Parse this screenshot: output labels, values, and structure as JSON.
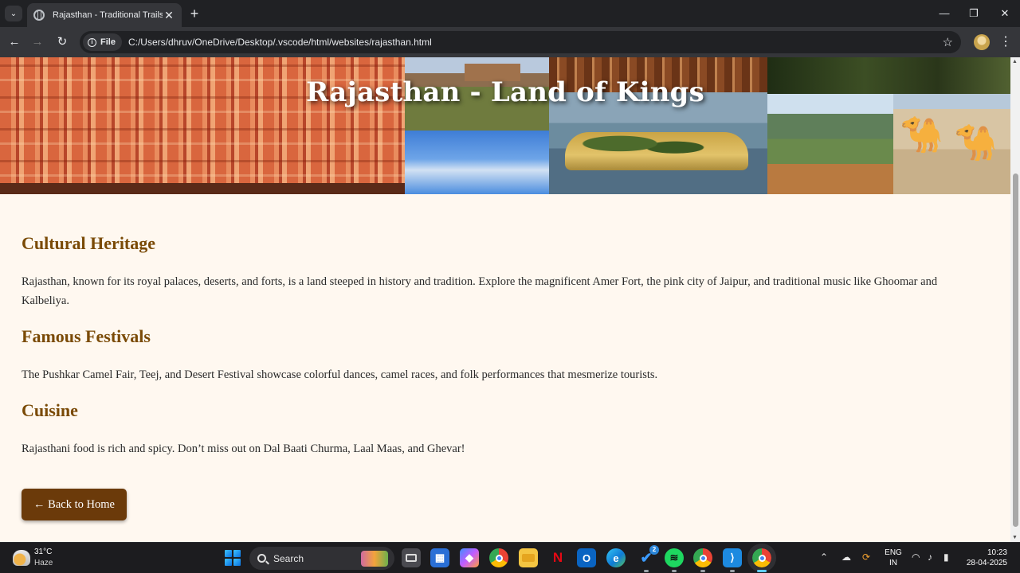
{
  "browser": {
    "tab_title": "Rajasthan - Traditional Trails",
    "tab_close": "✕",
    "new_tab": "+",
    "chip_label": "File",
    "url": "C:/Users/dhruv/OneDrive/Desktop/.vscode/html/websites/rajasthan.html",
    "bookmark_icon": "star-icon"
  },
  "page": {
    "banner_title": "Rajasthan - Land of Kings",
    "sections": [
      {
        "heading": "Cultural Heritage",
        "text": "Rajasthan, known for its royal palaces, deserts, and forts, is a land steeped in history and tradition. Explore the magnificent Amer Fort, the pink city of Jaipur, and traditional music like Ghoomar and Kalbeliya."
      },
      {
        "heading": "Famous Festivals",
        "text": "The Pushkar Camel Fair, Teej, and Desert Festival showcase colorful dances, camel races, and folk performances that mesmerize tourists."
      },
      {
        "heading": "Cuisine",
        "text": "Rajasthani food is rich and spicy. Don’t miss out on Dal Baati Churma, Laal Maas, and Ghevar!"
      }
    ],
    "back_button": "← Back to Home",
    "colors": {
      "background": "#fff8f0",
      "heading": "#7a4a06",
      "button": "#6b3a0a"
    }
  },
  "taskbar": {
    "weather_temp": "31°C",
    "weather_cond": "Haze",
    "search_label": "Search",
    "apps": [
      "task-view-icon",
      "microsoft-store-icon",
      "copilot-icon",
      "chrome-icon",
      "file-explorer-icon",
      "netflix-icon",
      "outlook-icon",
      "edge-icon",
      "todo-icon",
      "spotify-icon",
      "chrome-icon",
      "vscode-icon",
      "chrome-icon"
    ],
    "todo_badge": "2",
    "lang_top": "ENG",
    "lang_bottom": "IN",
    "time": "10:23",
    "date": "28-04-2025"
  }
}
